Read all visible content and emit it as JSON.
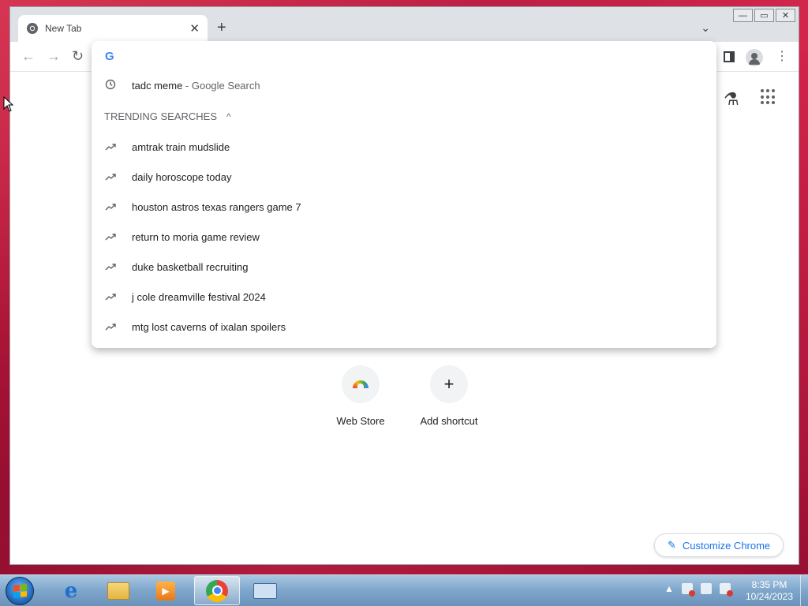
{
  "browser": {
    "tab_title": "New Tab",
    "tab_close": "✕",
    "new_tab": "+",
    "tab_search": "⌄",
    "window_controls": {
      "minimize": "—",
      "restore": "▭",
      "close": "✕"
    }
  },
  "toolbar": {
    "back": "←",
    "forward": "→",
    "reload": "↻",
    "menu": "⋮"
  },
  "omnibox": {
    "logo": "G",
    "history": {
      "icon": "clock-icon",
      "query": "tadc meme",
      "suffix": " - Google Search"
    },
    "trending_header": "TRENDING SEARCHES",
    "trending_toggle": "^",
    "trending": [
      {
        "icon": "trend-icon",
        "text": "amtrak train mudslide"
      },
      {
        "icon": "trend-icon",
        "text": "daily horoscope today"
      },
      {
        "icon": "trend-icon",
        "text": "houston astros texas rangers game 7"
      },
      {
        "icon": "trend-icon",
        "text": "return to moria game review"
      },
      {
        "icon": "trend-icon",
        "text": "duke basketball recruiting"
      },
      {
        "icon": "trend-icon",
        "text": "j cole dreamville festival 2024"
      },
      {
        "icon": "trend-icon",
        "text": "mtg lost caverns of ixalan spoilers"
      }
    ]
  },
  "newtab": {
    "labs_icon": "⚗",
    "shortcuts": [
      {
        "label": "Web Store",
        "icon": "web-store-icon"
      },
      {
        "label": "Add shortcut",
        "icon": "plus-icon",
        "glyph": "+"
      }
    ],
    "customize_label": "Customize Chrome",
    "customize_icon": "✎"
  },
  "taskbar": {
    "time": "8:35 PM",
    "date": "10/24/2023",
    "tray_toggle": "▲"
  },
  "colors": {
    "accent": "#1a73e8",
    "desktop": "#c81f3f",
    "taskbar": "#7ea6cb"
  }
}
